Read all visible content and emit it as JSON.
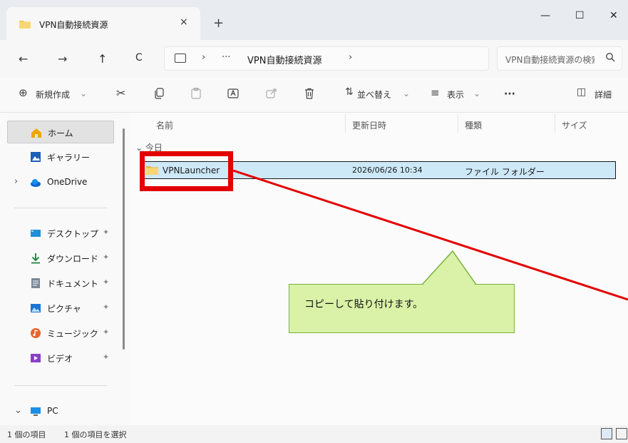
{
  "window": {
    "tab_title": "VPN自動接続資源",
    "tab_close": "×",
    "new_tab": "+",
    "minimize": "—",
    "maximize": "☐",
    "close": "✕"
  },
  "nav": {
    "back": "←",
    "forward": "→",
    "up": "↑",
    "refresh": "C"
  },
  "address": {
    "sep1": "›",
    "more": "···",
    "crumb": "VPN自動接続資源",
    "sep2": "›"
  },
  "search": {
    "placeholder": "VPN自動接続資源の検索",
    "icon": "search-icon"
  },
  "toolbar": {
    "new_label": "新規作成",
    "new_chevron": "⌄",
    "sort_label": "並べ替え",
    "sort_chevron": "⌄",
    "view_label": "表示",
    "view_chevron": "⌄",
    "more": "···",
    "details_label": "詳細"
  },
  "sidebar": {
    "items": [
      {
        "label": "ホーム",
        "icon": "home-icon"
      },
      {
        "label": "ギャラリー",
        "icon": "gallery-icon"
      },
      {
        "label": "OneDrive",
        "icon": "onedrive-icon"
      },
      {
        "label": "デスクトップ",
        "icon": "desktop-icon"
      },
      {
        "label": "ダウンロード",
        "icon": "download-icon"
      },
      {
        "label": "ドキュメント",
        "icon": "document-icon"
      },
      {
        "label": "ピクチャ",
        "icon": "pictures-icon"
      },
      {
        "label": "ミュージック",
        "icon": "music-icon"
      },
      {
        "label": "ビデオ",
        "icon": "video-icon"
      },
      {
        "label": "PC",
        "icon": "pc-icon"
      }
    ],
    "expand": "›",
    "collapse": "⌄",
    "pin": "📌"
  },
  "columns": {
    "name": "名前",
    "date": "更新日時",
    "type": "種類",
    "size": "サイズ"
  },
  "group": {
    "label": "今日",
    "toggle": "⌄"
  },
  "rows": [
    {
      "name": "VPNLauncher",
      "date": "2026/06/26 10:34",
      "type": "ファイル フォルダー",
      "size": ""
    }
  ],
  "annotation": {
    "callout": "コピーして貼り付けます。"
  },
  "status": {
    "count": "1 個の項目",
    "selected": "1 個の項目を選択"
  },
  "colors": {
    "accent": "#0078d4",
    "selection": "#cde8f7",
    "annotation_red": "#e30000",
    "callout_fill": "#d9f2a7",
    "folder": "#f2c94c"
  }
}
